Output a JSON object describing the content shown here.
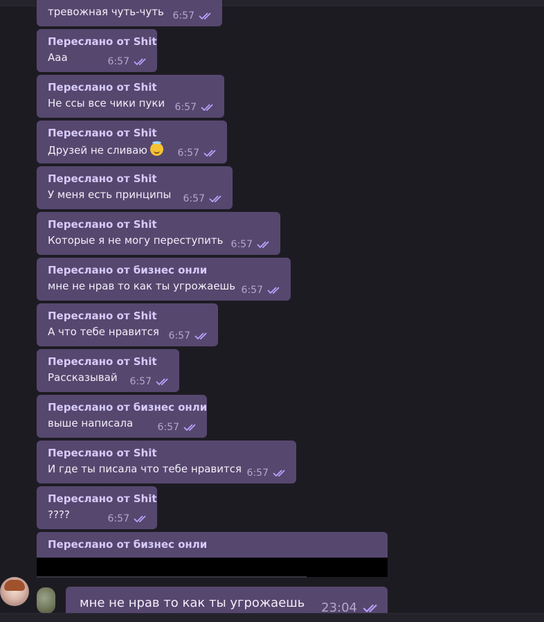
{
  "colors": {
    "background": "#1d1b22",
    "bubble": "#56476f",
    "forward_label": "#d6cbfa",
    "checkmarks": "#b7a3ff"
  },
  "messages": [
    {
      "forward": "",
      "text": "тревожная чуть-чуть",
      "time": "6:57"
    },
    {
      "forward": "Переслано от Shit",
      "text": "Ааа",
      "time": "6:57"
    },
    {
      "forward": "Переслано от Shit",
      "text": "Не ссы все чики пуки",
      "time": "6:57"
    },
    {
      "forward": "Переслано от Shit",
      "text": "Друзей не сливаю",
      "emoji": "smiling-face-with-halo",
      "time": "6:57"
    },
    {
      "forward": "Переслано от Shit",
      "text": "У меня есть принципы",
      "time": "6:57"
    },
    {
      "forward": "Переслано от Shit",
      "text": "Которые я не могу переступить",
      "time": "6:57"
    },
    {
      "forward": "Переслано от бизнес онли",
      "text": "мне не нрав то как ты угрожаешь",
      "time": "6:57"
    },
    {
      "forward": "Переслано от Shit",
      "text": "А что тебе нравится",
      "time": "6:57"
    },
    {
      "forward": "Переслано от Shit",
      "text": "Рассказывай",
      "time": "6:57"
    },
    {
      "forward": "Переслано от бизнес онли",
      "text": "выше написала",
      "time": "6:57"
    },
    {
      "forward": "Переслано от Shit",
      "text": "И где ты писала что тебе нравится",
      "time": "6:57"
    },
    {
      "forward": "Переслано от Shit",
      "text": "????",
      "time": "6:57"
    },
    {
      "forward": "Переслано от бизнес онли",
      "text": "",
      "time": ""
    }
  ],
  "reply": {
    "text": "мне не нрав то как ты угрожаешь",
    "time": "23:04"
  }
}
